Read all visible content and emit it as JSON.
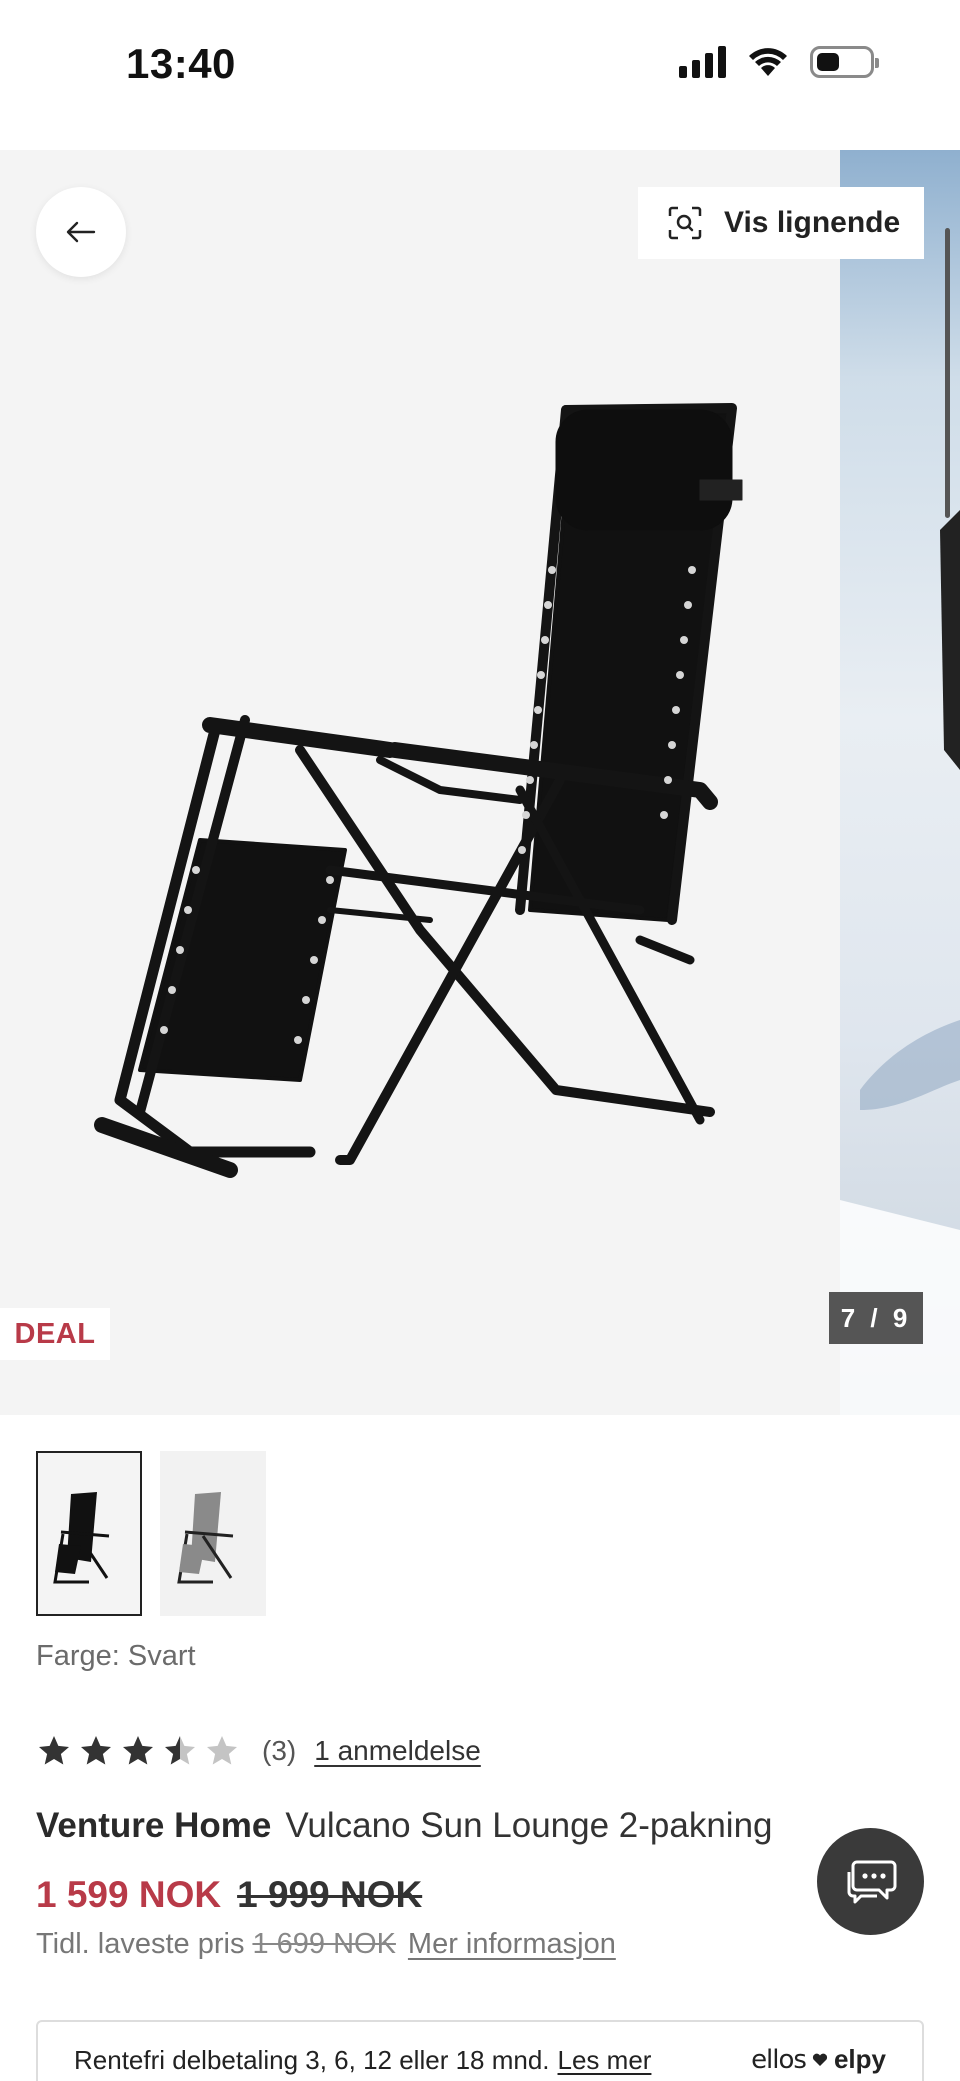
{
  "status_bar": {
    "time": "13:40"
  },
  "gallery": {
    "similar_button_label": "Vis lignende",
    "deal_badge": "DEAL",
    "counter": "7 / 9"
  },
  "product": {
    "color_label": "Farge: Svart",
    "rating": {
      "value": 3.5,
      "max": 5,
      "count_text": "(3)",
      "reviews_link": "1 anmeldelse"
    },
    "brand": "Venture Home",
    "name": "Vulcano Sun Lounge 2-pakning",
    "price_now": "1 599 NOK",
    "price_old": "1 999 NOK",
    "lowest_label": "Tidl. laveste pris",
    "lowest_price": "1 699 NOK",
    "more_info_link": "Mer informasjon"
  },
  "installment": {
    "text": "Rentefri delbetaling 3, 6, 12 eller 18 mnd.",
    "link": "Les mer",
    "logo_ellos": "ellos",
    "logo_elpy": "elpy"
  },
  "colors": {
    "accent_red": "#b83a48",
    "text_dark": "#2a2a2a",
    "chat_bg": "#3a3a3a"
  },
  "icons": [
    "back-arrow-icon",
    "visual-search-icon",
    "chat-icon",
    "heart-icon",
    "star-icon",
    "signal-icon",
    "wifi-icon",
    "battery-icon"
  ]
}
